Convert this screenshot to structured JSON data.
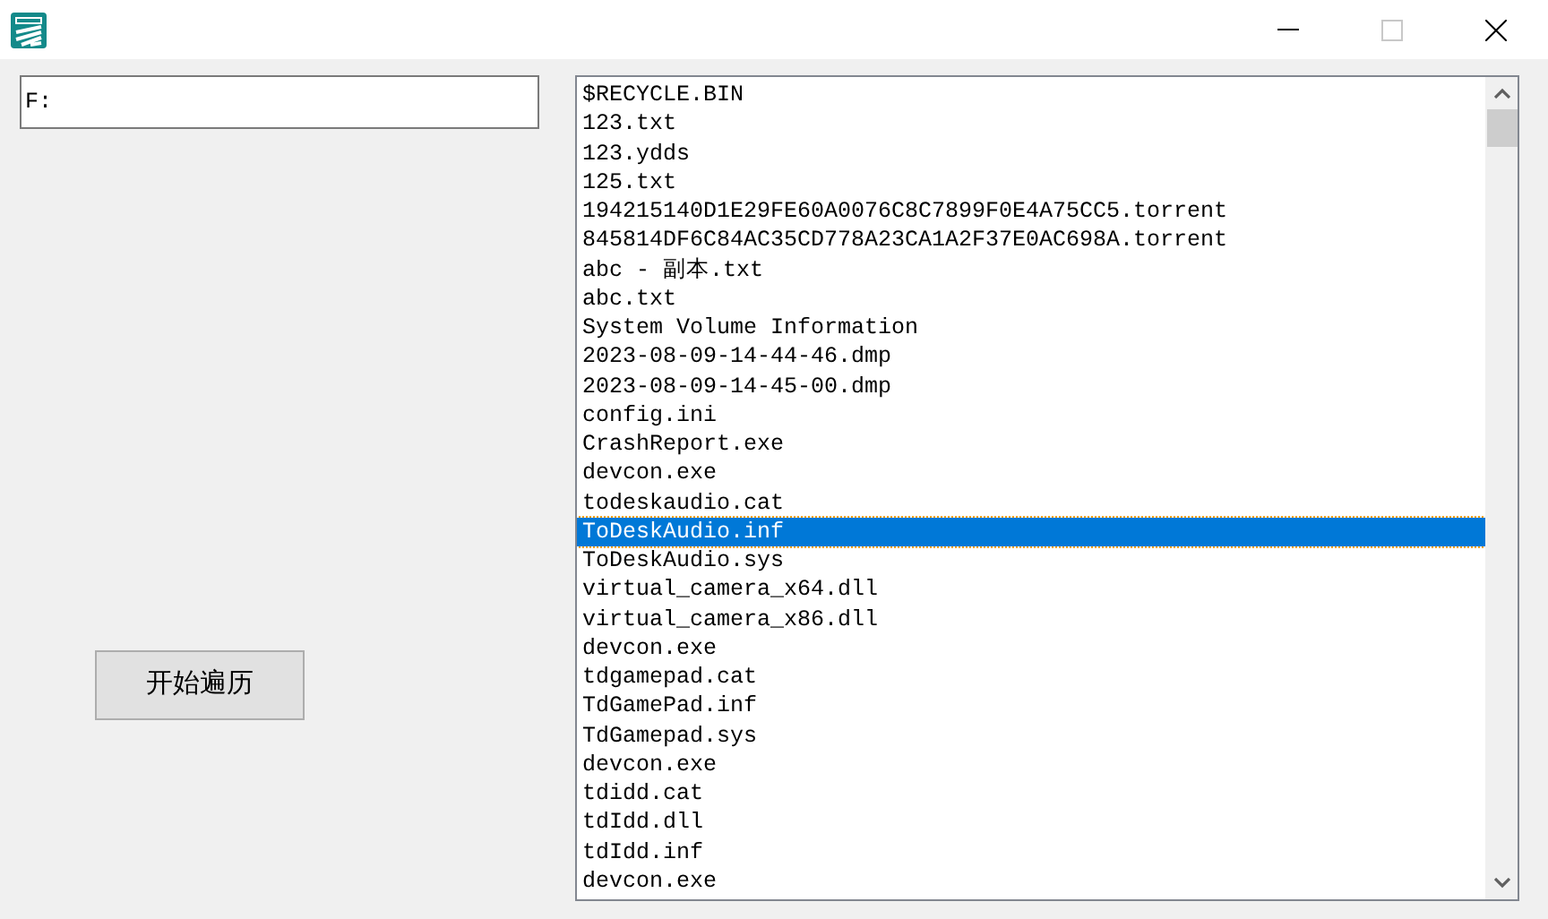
{
  "title_bar": {
    "maximize_disabled": true
  },
  "path_field": {
    "value": "F:"
  },
  "start_button": {
    "label": "开始遍历"
  },
  "file_list": {
    "items": [
      {
        "name": "$RECYCLE.BIN",
        "selected": false
      },
      {
        "name": "123.txt",
        "selected": false
      },
      {
        "name": "123.ydds",
        "selected": false
      },
      {
        "name": "125.txt",
        "selected": false
      },
      {
        "name": "194215140D1E29FE60A0076C8C7899F0E4A75CC5.torrent",
        "selected": false
      },
      {
        "name": "845814DF6C84AC35CD778A23CA1A2F37E0AC698A.torrent",
        "selected": false
      },
      {
        "name": "abc - 副本.txt",
        "selected": false
      },
      {
        "name": "abc.txt",
        "selected": false
      },
      {
        "name": "System Volume Information",
        "selected": false
      },
      {
        "name": "2023-08-09-14-44-46.dmp",
        "selected": false
      },
      {
        "name": "2023-08-09-14-45-00.dmp",
        "selected": false
      },
      {
        "name": "config.ini",
        "selected": false
      },
      {
        "name": "CrashReport.exe",
        "selected": false
      },
      {
        "name": "devcon.exe",
        "selected": false
      },
      {
        "name": "todeskaudio.cat",
        "selected": false
      },
      {
        "name": "ToDeskAudio.inf",
        "selected": true
      },
      {
        "name": "ToDeskAudio.sys",
        "selected": false
      },
      {
        "name": "virtual_camera_x64.dll",
        "selected": false
      },
      {
        "name": "virtual_camera_x86.dll",
        "selected": false
      },
      {
        "name": "devcon.exe",
        "selected": false
      },
      {
        "name": "tdgamepad.cat",
        "selected": false
      },
      {
        "name": "TdGamePad.inf",
        "selected": false
      },
      {
        "name": "TdGamepad.sys",
        "selected": false
      },
      {
        "name": "devcon.exe",
        "selected": false
      },
      {
        "name": "tdidd.cat",
        "selected": false
      },
      {
        "name": "tdIdd.dll",
        "selected": false
      },
      {
        "name": "tdIdd.inf",
        "selected": false
      },
      {
        "name": "devcon.exe",
        "selected": false
      }
    ]
  }
}
